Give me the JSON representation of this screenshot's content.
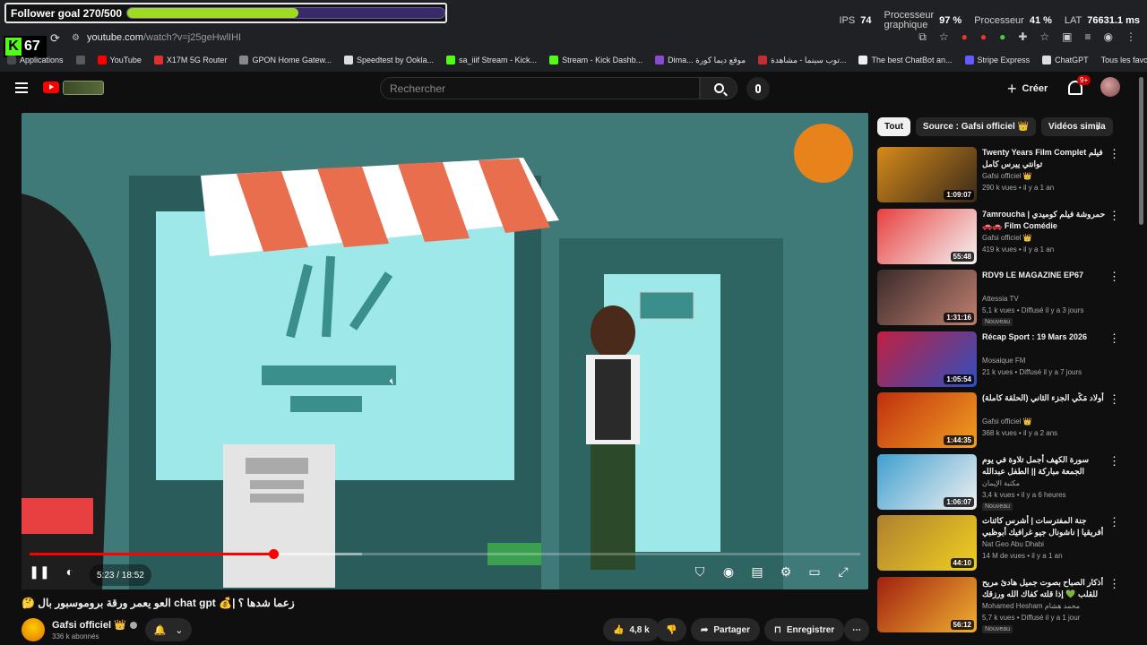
{
  "overlay": {
    "follower_goal": "Follower goal 270/500",
    "follower_progress": 0.54,
    "kick_count": "67"
  },
  "hud": {
    "ips_label": "IPS",
    "ips_value": "74",
    "gpu_label_1": "Processeur",
    "gpu_label_2": "graphique",
    "gpu_value": "97 %",
    "cpu_label": "Processeur",
    "cpu_value": "41 %",
    "lat_label": "LAT",
    "lat_value": "76631.1 ms"
  },
  "browser": {
    "url_host": "youtube.com",
    "url_path": "/watch?v=j25geHwlIHI",
    "bookmarks": [
      {
        "label": "Applications",
        "color": "#4a4a4a"
      },
      {
        "label": "",
        "color": "#5a5a5a"
      },
      {
        "label": "YouTube",
        "color": "#ff0000"
      },
      {
        "label": "X17M 5G Router",
        "color": "#e03030"
      },
      {
        "label": "GPON Home Gatew...",
        "color": "#888888"
      },
      {
        "label": "Speedtest by Ookla...",
        "color": "#dddddd"
      },
      {
        "label": "sa_iiif Stream - Kick...",
        "color": "#53fc18"
      },
      {
        "label": "Stream - Kick Dashb...",
        "color": "#53fc18"
      },
      {
        "label": "Dima... موقع ديما كورة",
        "color": "#8a4ad0"
      },
      {
        "label": "توب سينما - مشاهدة...",
        "color": "#c03030"
      },
      {
        "label": "The best ChatBot an...",
        "color": "#eeeeee"
      },
      {
        "label": "Stripe Express",
        "color": "#635bff"
      },
      {
        "label": "ChatGPT",
        "color": "#dddddd"
      }
    ],
    "all_bookmarks": "Tous les favoris"
  },
  "yt_header": {
    "search_placeholder": "Rechercher",
    "create_label": "Créer",
    "notif_badge": "9+"
  },
  "video": {
    "time": "5:23 / 18:52",
    "played_fraction": 0.293,
    "buffered_fraction": 0.4,
    "title": "زعما شدها ؟ |💰 chat gpt العو يعمر ورقة بروموسبور بال 🤔",
    "channel": "Gafsi officiel 👑",
    "subscribers": "336 k abonnés",
    "likes": "4,8 k",
    "share_label": "Partager",
    "save_label": "Enregistrer"
  },
  "sidebar": {
    "chips": [
      "Tout",
      "Source : Gafsi officiel 👑",
      "Vidéos simila"
    ],
    "items": [
      {
        "title": "Twenty Years Film Complet فيلم توانتي ييرس كامل",
        "channel": "Gafsi officiel 👑",
        "meta": "290 k vues • il y a 1 an",
        "duration": "1:09:07",
        "badge": "",
        "colors": [
          "#d58a1a",
          "#3a2a1a"
        ]
      },
      {
        "title": "7amroucha | حمروشة فيلم كوميدي 🚗🚗 Film Comédie",
        "channel": "Gafsi officiel 👑",
        "meta": "419 k vues • il y a 1 an",
        "duration": "55:48",
        "badge": "",
        "colors": [
          "#e84040",
          "#f5f5f5"
        ]
      },
      {
        "title": "RDV9 LE MAGAZINE EP67",
        "channel": "Attessia TV",
        "meta": "5,1 k vues • Diffusé il y a 3 jours",
        "duration": "1:31:16",
        "badge": "Nouveau",
        "colors": [
          "#3a2a2a",
          "#c08070"
        ]
      },
      {
        "title": "Récap Sport : 19 Mars 2026",
        "channel": "Mosaique FM",
        "meta": "21 k vues • Diffusé il y a 7 jours",
        "duration": "1:05:54",
        "badge": "",
        "colors": [
          "#c02040",
          "#3050c0"
        ]
      },
      {
        "title": "أولاد مَكِّي الجزء الثاني (الحلقة كاملة)",
        "channel": "Gafsi officiel 👑",
        "meta": "368 k vues • il y a 2 ans",
        "duration": "1:44:35",
        "badge": "",
        "colors": [
          "#c03010",
          "#f0a020"
        ]
      },
      {
        "title": "سورة الكهف أجمل تلاوة في يوم الجمعة مباركة || الطفل عبدالله شعبان | Surah Al",
        "channel": "مكتبة الإيمان",
        "meta": "3,4 k vues • il y a 6 heures",
        "duration": "1:06:07",
        "badge": "Nouveau",
        "colors": [
          "#40a0d0",
          "#f0f0f0"
        ]
      },
      {
        "title": "جنة المفترسات | أشرس كائنات أفريقيا | ناشونال جيو غرافيك أبوظبي",
        "channel": "Nat Geo Abu Dhabi",
        "meta": "14 M de vues • il y a 1 an",
        "duration": "44:10",
        "badge": "",
        "colors": [
          "#b08030",
          "#f0d020"
        ]
      },
      {
        "title": "أذكار الصباح بصوت جميل هادئ مريح للقلب 💚 إذا قلته كفاك الله ورزقك من حيث لا",
        "channel": "Mohamed Hesham محمد هشام",
        "meta": "5,7 k vues • Diffusé il y a 1 jour",
        "duration": "56:12",
        "badge": "Nouveau",
        "colors": [
          "#a02010",
          "#f0b030"
        ]
      }
    ]
  }
}
